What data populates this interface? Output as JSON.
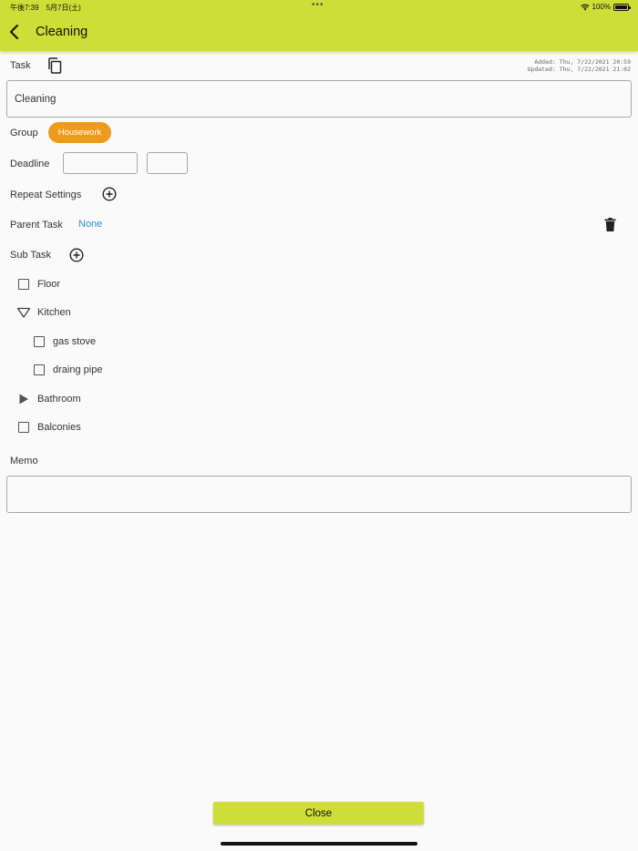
{
  "status_bar": {
    "time": "午後7:39　5月7日(土)",
    "dots": "•••",
    "battery": "100%"
  },
  "header": {
    "title": "Cleaning",
    "back_icon": "chevron-left-icon"
  },
  "task": {
    "label": "Task",
    "value": "Cleaning",
    "added": "Added: Thu, 7/22/2021 20:59",
    "updated": "Updated: Thu, 7/22/2021 21:02"
  },
  "group": {
    "label": "Group",
    "chip": "Housework",
    "chip_color": "#ee9a1d"
  },
  "deadline": {
    "label": "Deadline",
    "date_value": "",
    "time_value": ""
  },
  "repeat": {
    "label": "Repeat Settings"
  },
  "parent": {
    "label": "Parent Task",
    "value": "None"
  },
  "subtask": {
    "label": "Sub Task",
    "items": [
      {
        "label": "Floor",
        "kind": "checkbox"
      },
      {
        "label": "Kitchen",
        "kind": "expanded"
      },
      {
        "label": "gas stove",
        "kind": "checkbox"
      },
      {
        "label": "draing pipe",
        "kind": "checkbox"
      },
      {
        "label": "Bathroom",
        "kind": "collapsed"
      },
      {
        "label": "Balconies",
        "kind": "checkbox"
      }
    ]
  },
  "memo": {
    "label": "Memo",
    "value": ""
  },
  "footer": {
    "close_label": "Close"
  },
  "colors": {
    "accent": "#cfdd37",
    "link": "#2a8fd6",
    "chip": "#ee9a1d"
  }
}
